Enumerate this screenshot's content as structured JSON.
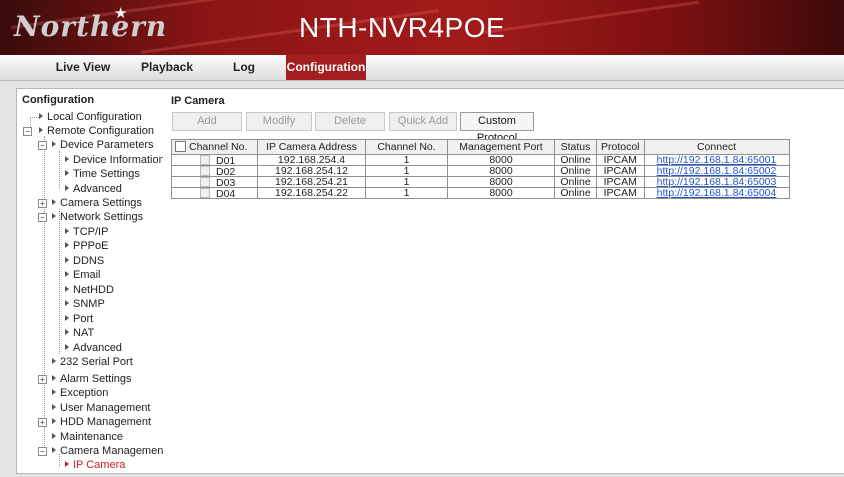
{
  "header": {
    "brand": "Northern",
    "brand_mark": "★",
    "product": "NTH-NVR4POE"
  },
  "nav": {
    "tabs": [
      {
        "label": "Live View"
      },
      {
        "label": "Playback"
      },
      {
        "label": "Log"
      },
      {
        "label": "Configuration",
        "active": true
      }
    ]
  },
  "sidebar": {
    "title": "Configuration",
    "items": [
      {
        "label": "Local Configuration"
      },
      {
        "label": "Remote Configuration",
        "expanded": true
      },
      {
        "label": "Device Parameters",
        "expanded": true
      },
      {
        "label": "Device Information"
      },
      {
        "label": "Time Settings"
      },
      {
        "label": "Advanced"
      },
      {
        "label": "Camera Settings",
        "expanded": false
      },
      {
        "label": "Network Settings",
        "expanded": true
      },
      {
        "label": "TCP/IP"
      },
      {
        "label": "PPPoE"
      },
      {
        "label": "DDNS"
      },
      {
        "label": "Email"
      },
      {
        "label": "NetHDD"
      },
      {
        "label": "SNMP"
      },
      {
        "label": "Port"
      },
      {
        "label": "NAT"
      },
      {
        "label": "Advanced"
      },
      {
        "label": "232 Serial Port"
      },
      {
        "label": "Alarm Settings",
        "expanded": false
      },
      {
        "label": "Exception"
      },
      {
        "label": "User Management"
      },
      {
        "label": "HDD Management",
        "expanded": false
      },
      {
        "label": "Maintenance"
      },
      {
        "label": "Camera Management",
        "expanded": true
      },
      {
        "label": "IP Camera",
        "active": true
      }
    ]
  },
  "main": {
    "title": "IP Camera",
    "buttons": {
      "add": "Add",
      "modify": "Modify",
      "delete": "Delete",
      "quick_add": "Quick Add",
      "custom_protocol": "Custom Protocol"
    },
    "table": {
      "columns": [
        "Channel No.",
        "IP Camera Address",
        "Channel No.",
        "Management Port",
        "Status",
        "Protocol",
        "Connect"
      ],
      "rows": [
        {
          "channel": "D01",
          "address": "192.168.254.4",
          "cam_channel": "1",
          "port": "8000",
          "status": "Online",
          "protocol": "IPCAM",
          "connect": "http://192.168.1.84:65001"
        },
        {
          "channel": "D02",
          "address": "192.168.254.12",
          "cam_channel": "1",
          "port": "8000",
          "status": "Online",
          "protocol": "IPCAM",
          "connect": "http://192.168.1.84:65002"
        },
        {
          "channel": "D03",
          "address": "192.168.254.21",
          "cam_channel": "1",
          "port": "8000",
          "status": "Online",
          "protocol": "IPCAM",
          "connect": "http://192.168.1.84:65003"
        },
        {
          "channel": "D04",
          "address": "192.168.254.22",
          "cam_channel": "1",
          "port": "8000",
          "status": "Online",
          "protocol": "IPCAM",
          "connect": "http://192.168.1.84:65004"
        }
      ]
    }
  },
  "colors": {
    "brand_red": "#a41d1f",
    "active_tree": "#d12020",
    "link": "#2255cc"
  }
}
